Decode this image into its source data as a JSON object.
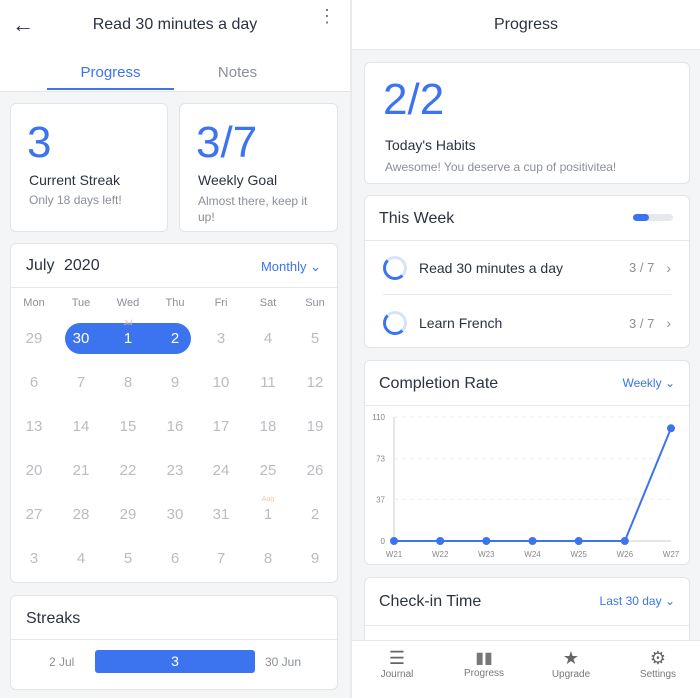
{
  "left": {
    "title": "Read 30 minutes a day",
    "tabs": [
      {
        "label": "Progress",
        "active": true
      },
      {
        "label": "Notes",
        "active": false
      }
    ],
    "streak": {
      "value": "3",
      "label": "Current Streak",
      "sub": "Only 18 days left!"
    },
    "goal": {
      "value": "3/7",
      "label": "Weekly Goal",
      "sub": "Almost there, keep it up!"
    },
    "calendar": {
      "month": "July",
      "year": "2020",
      "mode": "Monthly",
      "day_names": [
        "Mon",
        "Tue",
        "Wed",
        "Thu",
        "Fri",
        "Sat",
        "Sun"
      ],
      "weeks": [
        [
          "29",
          "30",
          "1",
          "2",
          "3",
          "4",
          "5"
        ],
        [
          "6",
          "7",
          "8",
          "9",
          "10",
          "11",
          "12"
        ],
        [
          "13",
          "14",
          "15",
          "16",
          "17",
          "18",
          "19"
        ],
        [
          "20",
          "21",
          "22",
          "23",
          "24",
          "25",
          "26"
        ],
        [
          "27",
          "28",
          "29",
          "30",
          "31",
          "1",
          "2"
        ],
        [
          "3",
          "4",
          "5",
          "6",
          "7",
          "8",
          "9"
        ]
      ],
      "month_markers": {
        "jul": "Jul",
        "aug": "Aug"
      },
      "selected": [
        "30",
        "1",
        "2"
      ]
    },
    "streaks": {
      "title": "Streaks",
      "start": "2 Jul",
      "count": "3",
      "end": "30 Jun"
    }
  },
  "right": {
    "title": "Progress",
    "today": {
      "value": "2/2",
      "label": "Today's Habits",
      "sub": "Awesome! You deserve a cup of positivitea!"
    },
    "week": {
      "title": "This Week",
      "progress": 0.4,
      "habits": [
        {
          "name": "Read 30 minutes a day",
          "count": "3 / 7"
        },
        {
          "name": "Learn French",
          "count": "3 / 7"
        }
      ]
    },
    "completion": {
      "title": "Completion Rate",
      "mode": "Weekly"
    },
    "checkin": {
      "title": "Check-in Time",
      "mode": "Last 30 day"
    },
    "nav": [
      {
        "label": "Journal",
        "icon": "journal-icon"
      },
      {
        "label": "Progress",
        "icon": "bar-chart-icon",
        "active": true
      },
      {
        "label": "Upgrade",
        "icon": "star-icon"
      },
      {
        "label": "Settings",
        "icon": "gear-icon"
      }
    ]
  },
  "chart_data": {
    "type": "line",
    "categories": [
      "W21",
      "W22",
      "W23",
      "W24",
      "W25",
      "W26",
      "W27"
    ],
    "values": [
      0,
      0,
      0,
      0,
      0,
      0,
      100
    ],
    "yticks": [
      "0",
      "37",
      "73",
      "110"
    ],
    "ylim": [
      0,
      110
    ],
    "grid": true,
    "color": "#3b74ee"
  }
}
